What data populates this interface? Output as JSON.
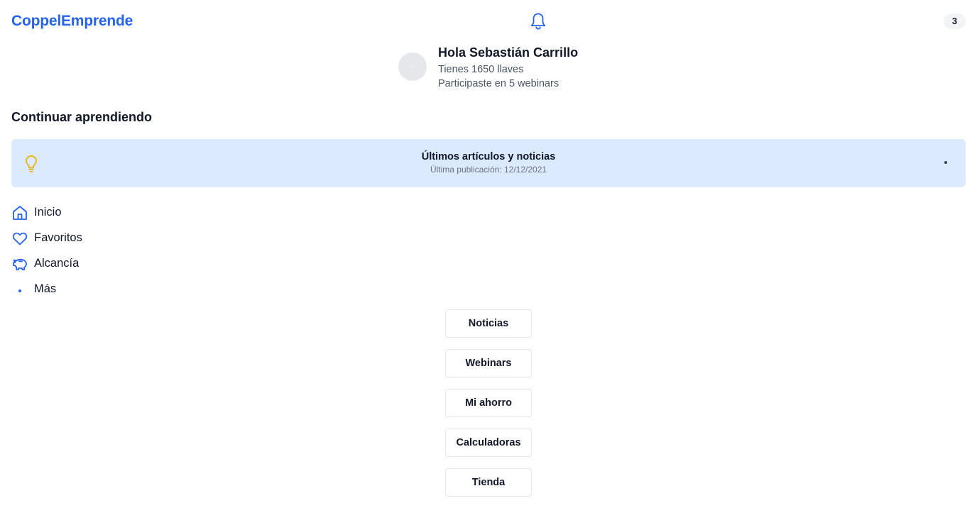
{
  "header": {
    "brand": "CoppelEmprende",
    "bell_icon": "bell-icon",
    "notification_count": "3"
  },
  "profile": {
    "greeting": "Hola Sebastián Carrillo",
    "keys": "Tienes 1650 llaves",
    "webinars": "Participaste en 5 webinars"
  },
  "section": {
    "title": "Continuar aprendiendo"
  },
  "news_card": {
    "icon": "lightbulb-icon",
    "title": "Últimos artículos y noticias",
    "subtitle": "Última publicación: 12/12/2021",
    "background": "#dbeafe",
    "icon_color": "#eab308"
  },
  "nav": {
    "items": [
      {
        "label": "Inicio",
        "icon": "home-icon"
      },
      {
        "label": "Favoritos",
        "icon": "heart-icon"
      },
      {
        "label": "Alcancía",
        "icon": "piggy-bank-icon"
      },
      {
        "label": "Más",
        "icon": "dot-icon"
      }
    ],
    "icon_color": "#2563eb"
  },
  "menu": {
    "buttons": [
      "Noticias",
      "Webinars",
      "Mi ahorro",
      "Calculadoras",
      "Tienda"
    ]
  },
  "colors": {
    "brand": "#2563eb",
    "text": "#111827",
    "muted": "#4b5563"
  }
}
